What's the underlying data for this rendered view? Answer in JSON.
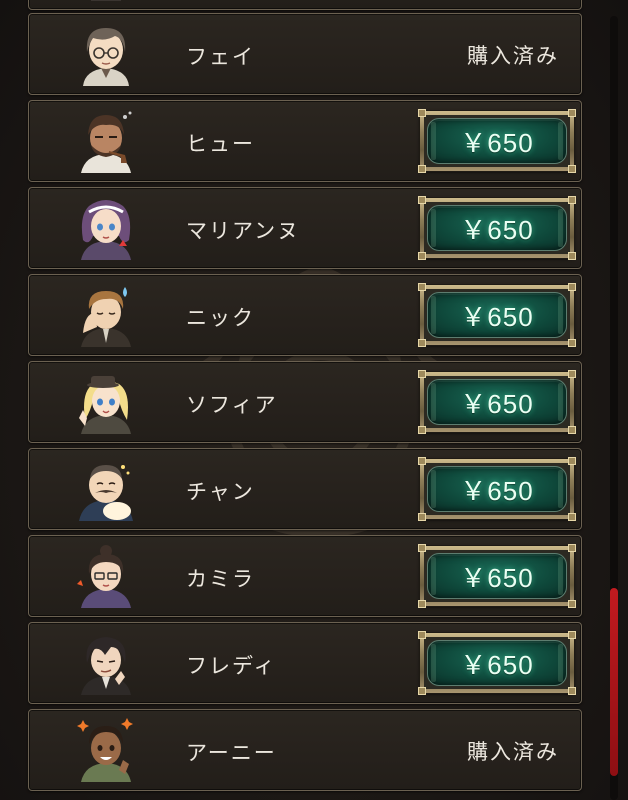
{
  "rows": [
    {
      "name": "",
      "status": "partial",
      "avatar": "character-avatar"
    },
    {
      "name": "フェイ",
      "status": "purchased",
      "label": "購入済み",
      "avatar": "fei-avatar"
    },
    {
      "name": "ヒュー",
      "status": "price",
      "label": "￥650",
      "avatar": "hugh-avatar"
    },
    {
      "name": "マリアンヌ",
      "status": "price",
      "label": "￥650",
      "avatar": "marianne-avatar"
    },
    {
      "name": "ニック",
      "status": "price",
      "label": "￥650",
      "avatar": "nick-avatar"
    },
    {
      "name": "ソフィア",
      "status": "price",
      "label": "￥650",
      "avatar": "sofia-avatar"
    },
    {
      "name": "チャン",
      "status": "price",
      "label": "￥650",
      "avatar": "chan-avatar"
    },
    {
      "name": "カミラ",
      "status": "price",
      "label": "￥650",
      "avatar": "camilla-avatar"
    },
    {
      "name": "フレディ",
      "status": "price",
      "label": "￥650",
      "avatar": "freddie-avatar"
    },
    {
      "name": "アーニー",
      "status": "purchased",
      "label": "購入済み",
      "avatar": "ernie-avatar"
    }
  ],
  "scroll": {
    "position": 0.96,
    "visible_fraction": 0.24
  },
  "colors": {
    "button_green": "#0f4a3c",
    "button_frame_gold": "#8e7e58",
    "row_background": "#26211c",
    "text": "#ece7de",
    "scrollbar": "#c21a1f"
  }
}
